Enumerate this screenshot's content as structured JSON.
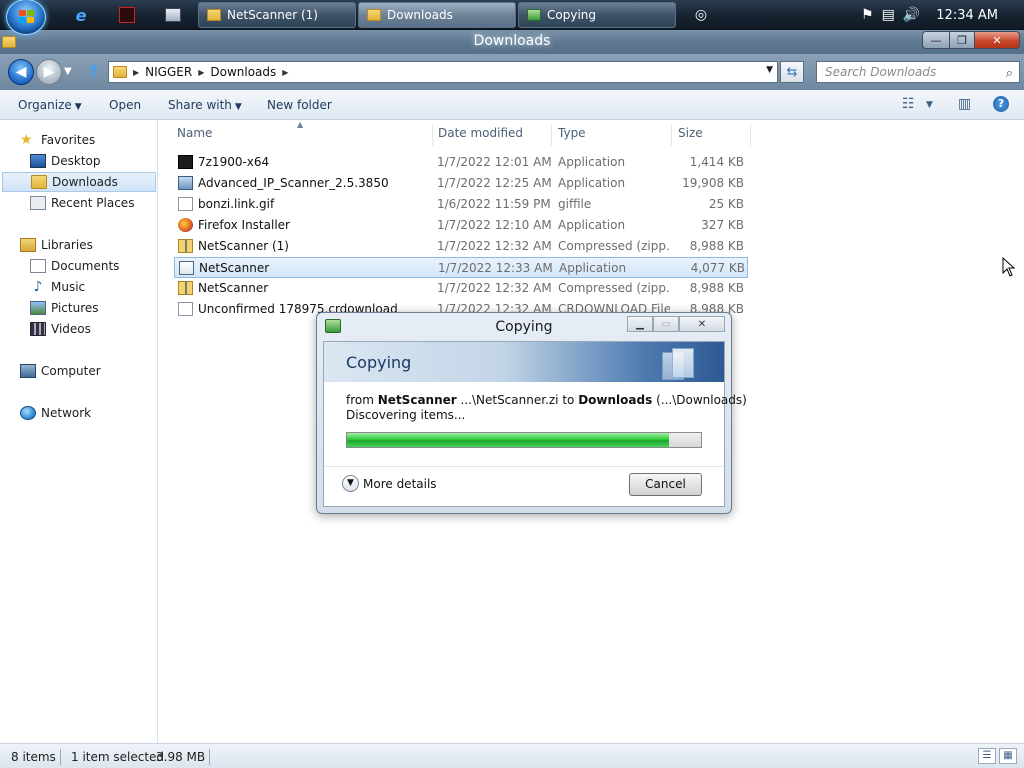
{
  "taskbar": {
    "buttons": [
      {
        "label": "NetScanner (1)"
      },
      {
        "label": "Downloads"
      },
      {
        "label": "Copying"
      }
    ],
    "clock": "12:34 AM"
  },
  "window": {
    "title": "Downloads",
    "min_glyph": "—",
    "max_glyph": "❐",
    "close_glyph": "✕"
  },
  "address": {
    "crumbs": [
      "NIGGER",
      "Downloads"
    ],
    "search_placeholder": "Search Downloads"
  },
  "toolbar": {
    "organize": "Organize",
    "open": "Open",
    "share_with": "Share with",
    "new_folder": "New folder"
  },
  "nav": {
    "favorites": "Favorites",
    "desktop": "Desktop",
    "downloads": "Downloads",
    "recent_places": "Recent Places",
    "libraries": "Libraries",
    "documents": "Documents",
    "music": "Music",
    "pictures": "Pictures",
    "videos": "Videos",
    "computer": "Computer",
    "network": "Network"
  },
  "columns": {
    "name": "Name",
    "date": "Date modified",
    "type": "Type",
    "size": "Size"
  },
  "files": [
    {
      "name": "7z1900-x64",
      "date": "1/7/2022 12:01 AM",
      "type": "Application",
      "size": "1,414 KB",
      "icon": "7z-icon"
    },
    {
      "name": "Advanced_IP_Scanner_2.5.3850",
      "date": "1/7/2022 12:25 AM",
      "type": "Application",
      "size": "19,908 KB",
      "icon": "installer-icon"
    },
    {
      "name": "bonzi.link.gif",
      "date": "1/6/2022 11:59 PM",
      "type": "giffile",
      "size": "25 KB",
      "icon": "file-icon"
    },
    {
      "name": "Firefox Installer",
      "date": "1/7/2022 12:10 AM",
      "type": "Application",
      "size": "327 KB",
      "icon": "firefox-icon"
    },
    {
      "name": "NetScanner (1)",
      "date": "1/7/2022 12:32 AM",
      "type": "Compressed (zipp...",
      "size": "8,988 KB",
      "icon": "zip-folder-icon"
    },
    {
      "name": "NetScanner",
      "date": "1/7/2022 12:33 AM",
      "type": "Application",
      "size": "4,077 KB",
      "icon": "application-icon"
    },
    {
      "name": "NetScanner",
      "date": "1/7/2022 12:32 AM",
      "type": "Compressed (zipp...",
      "size": "8,988 KB",
      "icon": "zip-folder-icon"
    },
    {
      "name": "Unconfirmed 178975.crdownload",
      "date": "1/7/2022 12:32 AM",
      "type": "CRDOWNLOAD File",
      "size": "8,988 KB",
      "icon": "file-icon"
    }
  ],
  "dialog": {
    "title": "Copying",
    "heading": "Copying",
    "from_prefix": "from",
    "from_source": "NetScanner",
    "from_path": "...\\NetScanner.zi",
    "to_word": "to",
    "to_dest": "Downloads",
    "to_path": "(...\\Downloads)",
    "status": "Discovering items...",
    "progress_percent": 91,
    "more_details": "More details",
    "cancel": "Cancel"
  },
  "status": {
    "items": "8 items",
    "selected": "1 item selected",
    "size": "3.98 MB"
  }
}
